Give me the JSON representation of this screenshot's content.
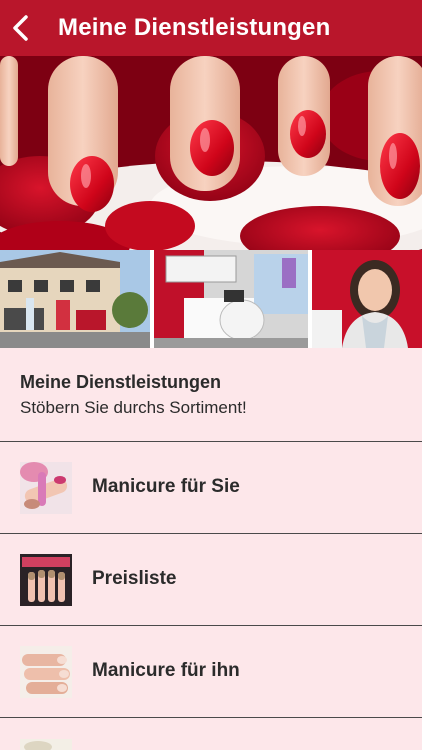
{
  "header": {
    "title": "Meine Dienstleistungen"
  },
  "intro": {
    "heading": "Meine Dienstleistungen",
    "subtitle": "Stöbern Sie durchs Sortiment!"
  },
  "services": [
    {
      "label": "Manicure für Sie",
      "icon": "manicure-photo-icon"
    },
    {
      "label": "Preisliste",
      "icon": "price-list-photo-icon"
    },
    {
      "label": "Manicure für ihn",
      "icon": "mens-manicure-photo-icon"
    }
  ],
  "colors": {
    "accent": "#b9162b",
    "background": "#fde7ea",
    "divider": "#4a4a4a"
  }
}
